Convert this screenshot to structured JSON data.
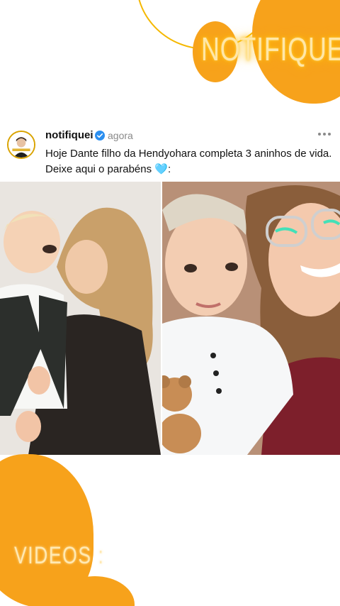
{
  "brand": {
    "logo_text": "NOTIFIQUEI"
  },
  "post": {
    "username": "notifiquei",
    "verified": true,
    "timestamp": "agora",
    "caption": "Hoje Dante filho da Hendyohara completa 3 aninhos de vida. Deixe aqui o parabéns 🩵:",
    "images": [
      {
        "name": "mother-holding-baby-photo"
      },
      {
        "name": "girl-with-child-and-teddy-photo"
      }
    ]
  },
  "footer": {
    "section_label": "VIDEOS :"
  },
  "colors": {
    "accent_orange": "#f7a21b",
    "accent_yellow": "#f5b800",
    "verified_blue": "#2b8ff0",
    "muted_text": "#8a8a8a"
  }
}
